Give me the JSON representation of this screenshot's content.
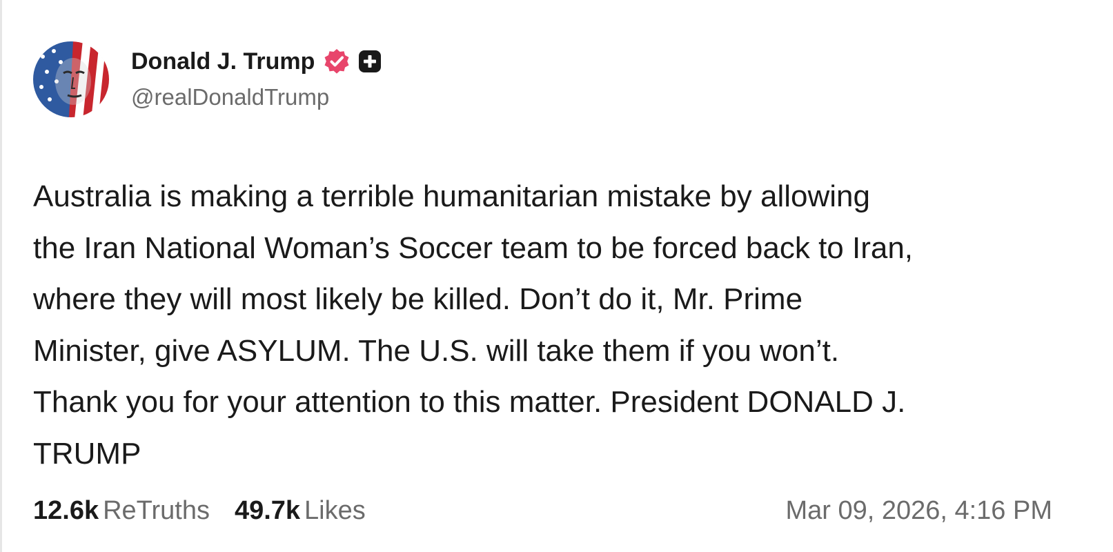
{
  "post": {
    "author": {
      "display_name": "Donald J. Trump",
      "handle": "@realDonaldTrump",
      "avatar_icon": "flag-face-avatar",
      "verified_icon": "verified-badge-icon",
      "verified_color": "#e8456b",
      "extra_icon": "plus-badge-icon"
    },
    "body": "Australia is making a terrible humanitarian mistake by allowing\nthe Iran National Woman’s Soccer team to be forced back to Iran,\nwhere they will most likely be killed. Don’t do it, Mr. Prime\nMinister, give ASYLUM. The U.S. will take them if you won’t.\nThank you for your attention to this matter. President DONALD J.\nTRUMP",
    "stats": {
      "retruths_count": "12.6k",
      "retruths_label": "ReTruths",
      "likes_count": "49.7k",
      "likes_label": "Likes"
    },
    "timestamp": "Mar 09, 2026, 4:16 PM"
  },
  "colors": {
    "text": "#1a1a1a",
    "muted": "#6b6b6b",
    "badge": "#e8456b"
  }
}
